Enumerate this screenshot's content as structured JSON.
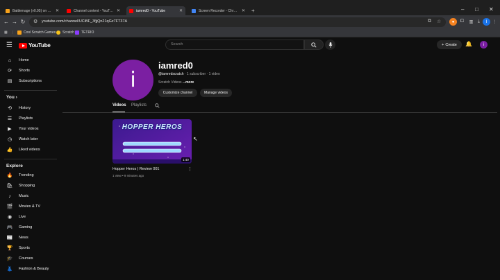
{
  "browser": {
    "tabs": [
      {
        "title": "Battlemage (v0.95) on Scratch",
        "fav_color": "#f7a21b",
        "active": false
      },
      {
        "title": "Channel content - YouTube Studio",
        "fav_color": "#ff0000",
        "active": false
      },
      {
        "title": "iamred0 - YouTube",
        "fav_color": "#ff0000",
        "active": true
      },
      {
        "title": "Screen Recorder - Chrome Web Store",
        "fav_color": "#4285f4",
        "active": false
      }
    ],
    "new_tab": "+",
    "window_controls": [
      "–",
      "□",
      "✕"
    ],
    "url": "youtube.com/channel/UCiBF_3fjjQn21qGz7FT37A",
    "profile_initial": "I",
    "bookmarks": [
      {
        "label": "Cool Scratch Games",
        "color": "#f7a21b"
      },
      {
        "label": "Scratch",
        "color": "#f7c31b"
      },
      {
        "label": "TETRIO",
        "color": "#8a3cff"
      }
    ]
  },
  "header": {
    "logo_text": "YouTube",
    "search_placeholder": "Search",
    "create_label": "Create",
    "avatar_initial": "i"
  },
  "sidebar": {
    "main": [
      {
        "label": "Home",
        "icon": "⌂"
      },
      {
        "label": "Shorts",
        "icon": "⟳"
      },
      {
        "label": "Subscriptions",
        "icon": "▤"
      }
    ],
    "you_heading": "You",
    "you": [
      {
        "label": "History",
        "icon": "⟲"
      },
      {
        "label": "Playlists",
        "icon": "☰"
      },
      {
        "label": "Your videos",
        "icon": "▶"
      },
      {
        "label": "Watch later",
        "icon": "◷"
      },
      {
        "label": "Liked videos",
        "icon": "👍"
      }
    ],
    "explore_heading": "Explore",
    "explore": [
      {
        "label": "Trending",
        "icon": "🔥"
      },
      {
        "label": "Shopping",
        "icon": "🛍"
      },
      {
        "label": "Music",
        "icon": "♪"
      },
      {
        "label": "Movies & TV",
        "icon": "🎬"
      },
      {
        "label": "Live",
        "icon": "◉"
      },
      {
        "label": "Gaming",
        "icon": "🎮"
      },
      {
        "label": "News",
        "icon": "📰"
      },
      {
        "label": "Sports",
        "icon": "🏆"
      },
      {
        "label": "Courses",
        "icon": "🎓"
      },
      {
        "label": "Fashion & Beauty",
        "icon": "👗"
      }
    ]
  },
  "channel": {
    "avatar_letter": "i",
    "name": "iamred0",
    "handle": "@iamredscratch",
    "meta_rest": " · 1 subscriber · 1 video",
    "description": "Scratch Videos",
    "more": "...more",
    "customize_label": "Customize channel",
    "manage_label": "Manage videos",
    "tabs": [
      "Videos",
      "Playlists"
    ]
  },
  "video": {
    "thumb_title": "HOPPER HEROS",
    "duration": "1:40",
    "title": "Hopper Heros | Review 001",
    "meta": "1 view • 9 minutes ago"
  },
  "colors": {
    "accent_purple": "#7b1fa2",
    "yt_red": "#ff0000",
    "bg": "#0f0f0f"
  }
}
